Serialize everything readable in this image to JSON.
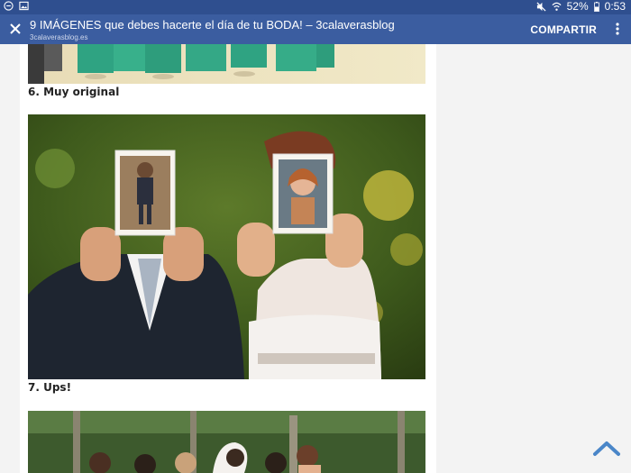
{
  "status_bar": {
    "battery": "52%",
    "time": "0:53",
    "icons": [
      "notification-icon",
      "image-icon",
      "mute-icon",
      "wifi-icon",
      "battery-icon"
    ]
  },
  "app_bar": {
    "title": "9 IMÁGENES que debes hacerte el día de tu BODA! – 3calaverasblog",
    "url": "3calaverasblog.es",
    "share_label": "COMPARTIR",
    "close_icon": "close-icon",
    "menu_icon": "more-vert-icon"
  },
  "article": {
    "captions": [
      "6. Muy original",
      "7. Ups!"
    ]
  },
  "colors": {
    "status_bar": "#2f4f8f",
    "app_bar": "#3b5da0",
    "scroll_top_button": "#4a86c8"
  }
}
